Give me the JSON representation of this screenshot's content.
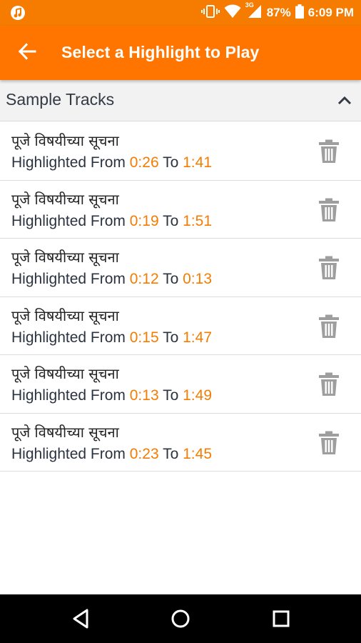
{
  "status_bar": {
    "battery_percent": "87%",
    "time": "6:09 PM",
    "network_label": "3G",
    "icons": [
      "music-note-icon",
      "vibrate-icon",
      "wifi-icon",
      "signal-icon",
      "battery-icon"
    ]
  },
  "app_bar": {
    "title": "Select a Highlight to Play",
    "back_icon": "arrow-back-icon"
  },
  "section": {
    "title": "Sample Tracks",
    "expanded": true
  },
  "labels": {
    "from": "Highlighted From",
    "to": "To"
  },
  "tracks": [
    {
      "title": "पूजे विषयीच्या सूचना",
      "from": "0:26",
      "to": "1:41"
    },
    {
      "title": "पूजे विषयीच्या सूचना",
      "from": "0:19",
      "to": "1:51"
    },
    {
      "title": "पूजे विषयीच्या सूचना",
      "from": "0:12",
      "to": "0:13"
    },
    {
      "title": "पूजे विषयीच्या सूचना",
      "from": "0:15",
      "to": "1:47"
    },
    {
      "title": "पूजे विषयीच्या सूचना",
      "from": "0:13",
      "to": "1:49"
    },
    {
      "title": "पूजे विषयीच्या सूचना",
      "from": "0:23",
      "to": "1:45"
    }
  ],
  "colors": {
    "accent": "#ff7500",
    "status_bar": "#f57c00",
    "time_text": "#f57c00",
    "icon_gray": "#9e9e9e"
  }
}
